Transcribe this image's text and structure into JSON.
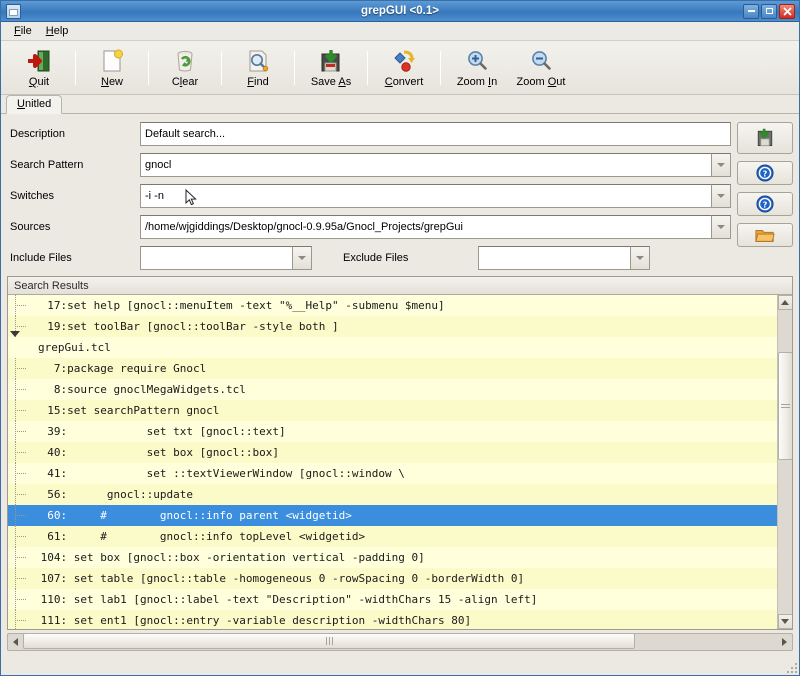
{
  "window": {
    "title": "grepGUI <0.1>",
    "icon": "window-icon",
    "controls": {
      "minimize": "–",
      "maximize": "□",
      "close": "✕"
    }
  },
  "menubar": {
    "items": [
      {
        "label": "File",
        "mnemonic": "F",
        "rest": "ile"
      },
      {
        "label": "Help",
        "mnemonic": "H",
        "rest": "elp"
      }
    ]
  },
  "toolbar": {
    "buttons": [
      {
        "label": "Quit",
        "pre": "",
        "mn": "Q",
        "post": "uit",
        "icon": "quit-icon"
      },
      {
        "label": "New",
        "pre": "",
        "mn": "N",
        "post": "ew",
        "icon": "new-icon"
      },
      {
        "label": "Clear",
        "pre": "C",
        "mn": "l",
        "post": "ear",
        "icon": "clear-icon"
      },
      {
        "label": "Find",
        "pre": "",
        "mn": "F",
        "post": "ind",
        "icon": "find-icon"
      },
      {
        "label": "Save As",
        "pre": "Save ",
        "mn": "A",
        "post": "s",
        "icon": "save-as-icon"
      },
      {
        "label": "Convert",
        "pre": "",
        "mn": "C",
        "post": "onvert",
        "icon": "convert-icon"
      },
      {
        "label": "Zoom In",
        "pre": "Zoom ",
        "mn": "I",
        "post": "n",
        "icon": "zoom-in-icon"
      },
      {
        "label": "Zoom Out",
        "pre": "Zoom ",
        "mn": "O",
        "post": "ut",
        "icon": "zoom-out-icon"
      }
    ]
  },
  "tabs": [
    {
      "label": "Unitled",
      "mn": "U",
      "rest": "nitled",
      "active": true
    }
  ],
  "form": {
    "description": {
      "label": "Description",
      "value": "Default search..."
    },
    "search_pattern": {
      "label": "Search Pattern",
      "value": "gnocl"
    },
    "switches": {
      "label": "Switches",
      "value": "-i -n"
    },
    "sources": {
      "label": "Sources",
      "value": "/home/wjgiddings/Desktop/gnocl-0.9.95a/Gnocl_Projects/grepGui"
    },
    "include_files": {
      "label": "Include Files",
      "value": ""
    },
    "exclude_files": {
      "label": "Exclude Files",
      "value": ""
    }
  },
  "side_buttons": [
    {
      "icon": "save-as-icon",
      "name": "save-as-side-button"
    },
    {
      "icon": "help-icon",
      "name": "search-pattern-help-button"
    },
    {
      "icon": "help-icon",
      "name": "switches-help-button"
    },
    {
      "icon": "folder-icon",
      "name": "browse-sources-button"
    }
  ],
  "results": {
    "header": "Search Results",
    "rows": [
      {
        "kind": "leaf",
        "text": "  17:set help [gnocl::menuItem -text \"%__Help\" -submenu $menu]",
        "selected": false
      },
      {
        "kind": "leaf",
        "text": "  19:set toolBar [gnocl::toolBar -style both ]",
        "selected": false
      },
      {
        "kind": "node",
        "text": "grepGui.tcl",
        "selected": false
      },
      {
        "kind": "leaf",
        "text": "   7:package require Gnocl",
        "selected": false
      },
      {
        "kind": "leaf",
        "text": "   8:source gnoclMegaWidgets.tcl",
        "selected": false
      },
      {
        "kind": "leaf",
        "text": "  15:set searchPattern gnocl",
        "selected": false
      },
      {
        "kind": "leaf",
        "text": "  39:            set txt [gnocl::text]",
        "selected": false
      },
      {
        "kind": "leaf",
        "text": "  40:            set box [gnocl::box]",
        "selected": false
      },
      {
        "kind": "leaf",
        "text": "  41:            set ::textViewerWindow [gnocl::window \\",
        "selected": false
      },
      {
        "kind": "leaf",
        "text": "  56:      gnocl::update",
        "selected": false
      },
      {
        "kind": "leaf",
        "text": "  60:     #        gnocl::info parent <widgetid>",
        "selected": true
      },
      {
        "kind": "leaf",
        "text": "  61:     #        gnocl::info topLevel <widgetid>",
        "selected": false
      },
      {
        "kind": "leaf",
        "text": " 104: set box [gnocl::box -orientation vertical -padding 0]",
        "selected": false
      },
      {
        "kind": "leaf",
        "text": " 107: set table [gnocl::table -homogeneous 0 -rowSpacing 0 -borderWidth 0]",
        "selected": false
      },
      {
        "kind": "leaf",
        "text": " 110: set lab1 [gnocl::label -text \"Description\" -widthChars 15 -align left]",
        "selected": false
      },
      {
        "kind": "leaf",
        "text": " 111: set ent1 [gnocl::entry -variable description -widthChars 80]",
        "selected": false
      }
    ]
  },
  "colors": {
    "titlebar": "#3f7fc1",
    "selection": "#3b8ede",
    "row_odd": "#ffffdc",
    "row_even": "#fbfbc9",
    "chrome": "#ece9e3"
  }
}
